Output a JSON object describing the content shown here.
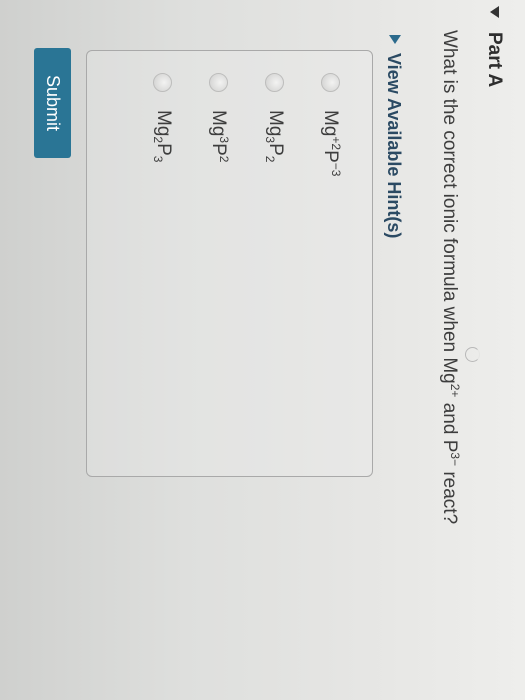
{
  "part": {
    "title": "Part A"
  },
  "question": {
    "text_1": "What is the correct ionic formula when Mg",
    "sup_1": "2+",
    "text_2": " and P",
    "sup_2": "3−",
    "text_3": " react?"
  },
  "hints": {
    "label": "View Available Hint(s)"
  },
  "options": [
    {
      "parts": [
        "Mg",
        "+2",
        "P",
        "−3"
      ]
    },
    {
      "parts": [
        "Mg",
        "3",
        "P",
        "2"
      ]
    },
    {
      "parts": [
        "Mg",
        "3",
        "P",
        "2"
      ]
    },
    {
      "parts": [
        "Mg",
        "2",
        "P",
        "3"
      ]
    }
  ],
  "submit": {
    "label": "Submit"
  }
}
